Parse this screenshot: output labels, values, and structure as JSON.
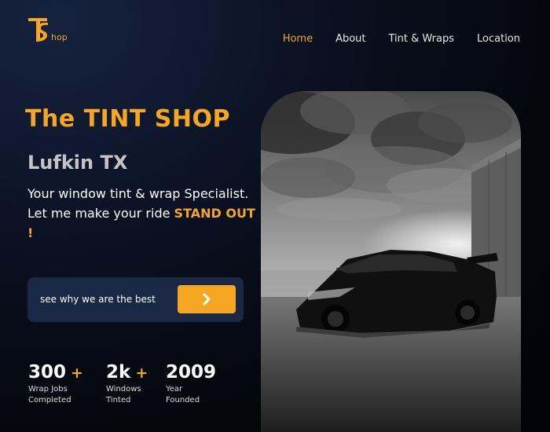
{
  "brand": {
    "logo_text": "hop",
    "accent": "#f5a623"
  },
  "nav": {
    "items": [
      {
        "label": "Home",
        "active": true
      },
      {
        "label": "About",
        "active": false
      },
      {
        "label": "Tint & Wraps",
        "active": false
      },
      {
        "label": "Location",
        "active": false
      }
    ]
  },
  "hero": {
    "title": "The TINT SHOP",
    "city": "Lufkin TX",
    "tagline_main": "Your window tint & wrap Specialist. Let me make your ride",
    "tagline_highlight": "STAND OUT !",
    "cta_text": "see why we are the best",
    "cta_icon": "chevron-right-icon",
    "image": "black sports car under cloudy sky"
  },
  "stats": [
    {
      "value": "300",
      "plus": "+",
      "label": "Wrap Jobs\nCompleted"
    },
    {
      "value": "2k",
      "plus": "+",
      "label": "Windows\nTinted"
    },
    {
      "value": "2009",
      "plus": "",
      "label": "Year\nFounded"
    }
  ]
}
